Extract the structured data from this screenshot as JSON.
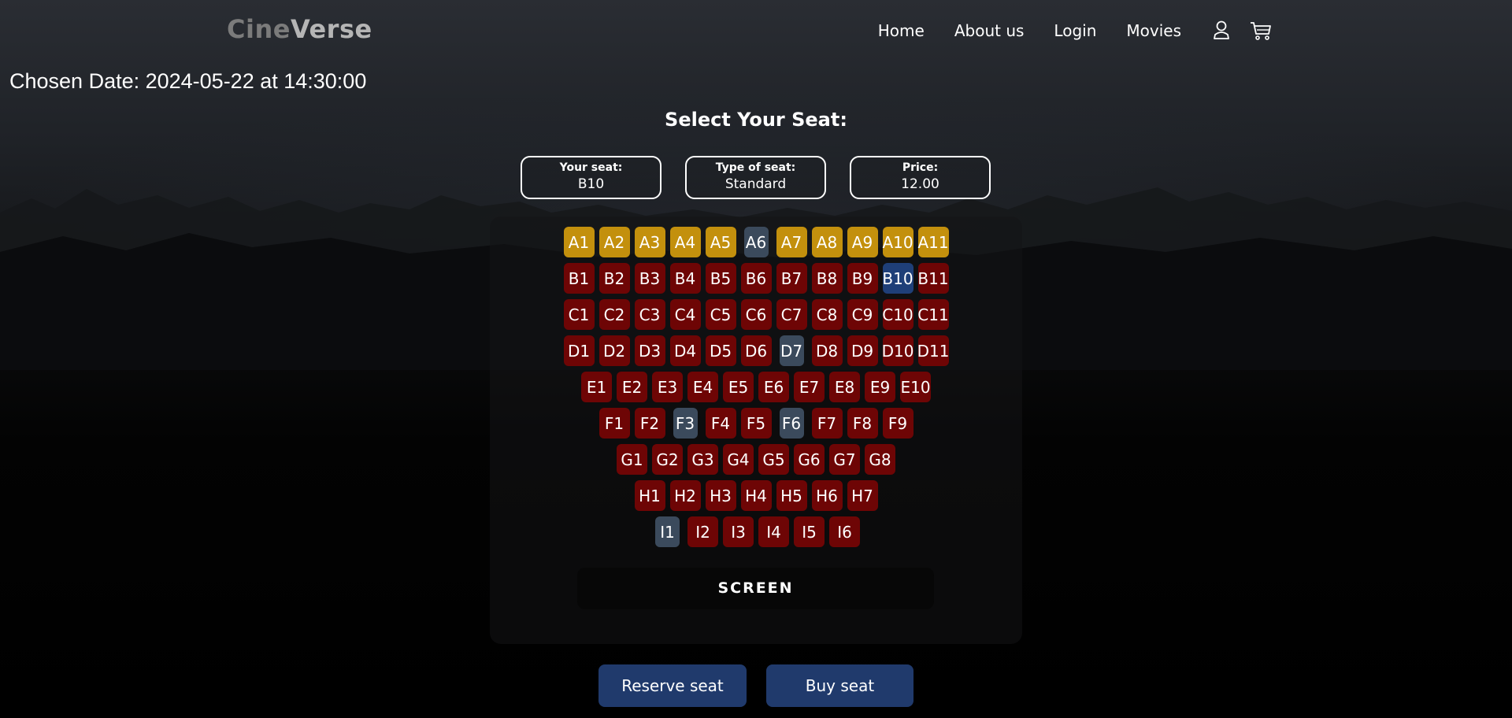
{
  "brand": {
    "part1": "Cine",
    "part2": "Verse"
  },
  "nav": {
    "links": [
      "Home",
      "About us",
      "Login",
      "Movies"
    ],
    "icons": [
      "user-icon",
      "cart-icon"
    ]
  },
  "chosen_date": "Chosen Date: 2024-05-22 at 14:30:00",
  "select_title": "Select Your Seat:",
  "info": {
    "seat_label": "Your seat:",
    "seat_value": "B10",
    "type_label": "Type of seat:",
    "type_value": "Standard",
    "price_label": "Price:",
    "price_value": "12.00"
  },
  "colors": {
    "available": "#6e0505",
    "vip": "#c3900d",
    "taken": "#3b4a5c",
    "selected": "#1f3f78",
    "button": "#203a6c"
  },
  "seat_rows": [
    {
      "row": "A",
      "seats": [
        {
          "label": "A1",
          "status": "vip"
        },
        {
          "label": "A2",
          "status": "vip"
        },
        {
          "label": "A3",
          "status": "vip"
        },
        {
          "label": "A4",
          "status": "vip"
        },
        {
          "label": "A5",
          "status": "vip"
        },
        {
          "label": "A6",
          "status": "taken"
        },
        {
          "label": "A7",
          "status": "vip"
        },
        {
          "label": "A8",
          "status": "vip"
        },
        {
          "label": "A9",
          "status": "vip"
        },
        {
          "label": "A10",
          "status": "vip"
        },
        {
          "label": "A11",
          "status": "vip"
        }
      ]
    },
    {
      "row": "B",
      "seats": [
        {
          "label": "B1",
          "status": "available"
        },
        {
          "label": "B2",
          "status": "available"
        },
        {
          "label": "B3",
          "status": "available"
        },
        {
          "label": "B4",
          "status": "available"
        },
        {
          "label": "B5",
          "status": "available"
        },
        {
          "label": "B6",
          "status": "available"
        },
        {
          "label": "B7",
          "status": "available"
        },
        {
          "label": "B8",
          "status": "available"
        },
        {
          "label": "B9",
          "status": "available"
        },
        {
          "label": "B10",
          "status": "selected"
        },
        {
          "label": "B11",
          "status": "available"
        }
      ]
    },
    {
      "row": "C",
      "seats": [
        {
          "label": "C1",
          "status": "available"
        },
        {
          "label": "C2",
          "status": "available"
        },
        {
          "label": "C3",
          "status": "available"
        },
        {
          "label": "C4",
          "status": "available"
        },
        {
          "label": "C5",
          "status": "available"
        },
        {
          "label": "C6",
          "status": "available"
        },
        {
          "label": "C7",
          "status": "available"
        },
        {
          "label": "C8",
          "status": "available"
        },
        {
          "label": "C9",
          "status": "available"
        },
        {
          "label": "C10",
          "status": "available"
        },
        {
          "label": "C11",
          "status": "available"
        }
      ]
    },
    {
      "row": "D",
      "seats": [
        {
          "label": "D1",
          "status": "available"
        },
        {
          "label": "D2",
          "status": "available"
        },
        {
          "label": "D3",
          "status": "available"
        },
        {
          "label": "D4",
          "status": "available"
        },
        {
          "label": "D5",
          "status": "available"
        },
        {
          "label": "D6",
          "status": "available"
        },
        {
          "label": "D7",
          "status": "taken"
        },
        {
          "label": "D8",
          "status": "available"
        },
        {
          "label": "D9",
          "status": "available"
        },
        {
          "label": "D10",
          "status": "available"
        },
        {
          "label": "D11",
          "status": "available"
        }
      ]
    },
    {
      "row": "E",
      "seats": [
        {
          "label": "E1",
          "status": "available"
        },
        {
          "label": "E2",
          "status": "available"
        },
        {
          "label": "E3",
          "status": "available"
        },
        {
          "label": "E4",
          "status": "available"
        },
        {
          "label": "E5",
          "status": "available"
        },
        {
          "label": "E6",
          "status": "available"
        },
        {
          "label": "E7",
          "status": "available"
        },
        {
          "label": "E8",
          "status": "available"
        },
        {
          "label": "E9",
          "status": "available"
        },
        {
          "label": "E10",
          "status": "available"
        }
      ]
    },
    {
      "row": "F",
      "seats": [
        {
          "label": "F1",
          "status": "available"
        },
        {
          "label": "F2",
          "status": "available"
        },
        {
          "label": "F3",
          "status": "taken"
        },
        {
          "label": "F4",
          "status": "available"
        },
        {
          "label": "F5",
          "status": "available"
        },
        {
          "label": "F6",
          "status": "taken"
        },
        {
          "label": "F7",
          "status": "available"
        },
        {
          "label": "F8",
          "status": "available"
        },
        {
          "label": "F9",
          "status": "available"
        }
      ]
    },
    {
      "row": "G",
      "seats": [
        {
          "label": "G1",
          "status": "available"
        },
        {
          "label": "G2",
          "status": "available"
        },
        {
          "label": "G3",
          "status": "available"
        },
        {
          "label": "G4",
          "status": "available"
        },
        {
          "label": "G5",
          "status": "available"
        },
        {
          "label": "G6",
          "status": "available"
        },
        {
          "label": "G7",
          "status": "available"
        },
        {
          "label": "G8",
          "status": "available"
        }
      ]
    },
    {
      "row": "H",
      "seats": [
        {
          "label": "H1",
          "status": "available"
        },
        {
          "label": "H2",
          "status": "available"
        },
        {
          "label": "H3",
          "status": "available"
        },
        {
          "label": "H4",
          "status": "available"
        },
        {
          "label": "H5",
          "status": "available"
        },
        {
          "label": "H6",
          "status": "available"
        },
        {
          "label": "H7",
          "status": "available"
        }
      ]
    },
    {
      "row": "I",
      "seats": [
        {
          "label": "I1",
          "status": "taken"
        },
        {
          "label": "I2",
          "status": "available"
        },
        {
          "label": "I3",
          "status": "available"
        },
        {
          "label": "I4",
          "status": "available"
        },
        {
          "label": "I5",
          "status": "available"
        },
        {
          "label": "I6",
          "status": "available"
        }
      ]
    }
  ],
  "screen_label": "SCREEN",
  "buttons": {
    "reserve": "Reserve seat",
    "buy": "Buy seat"
  }
}
